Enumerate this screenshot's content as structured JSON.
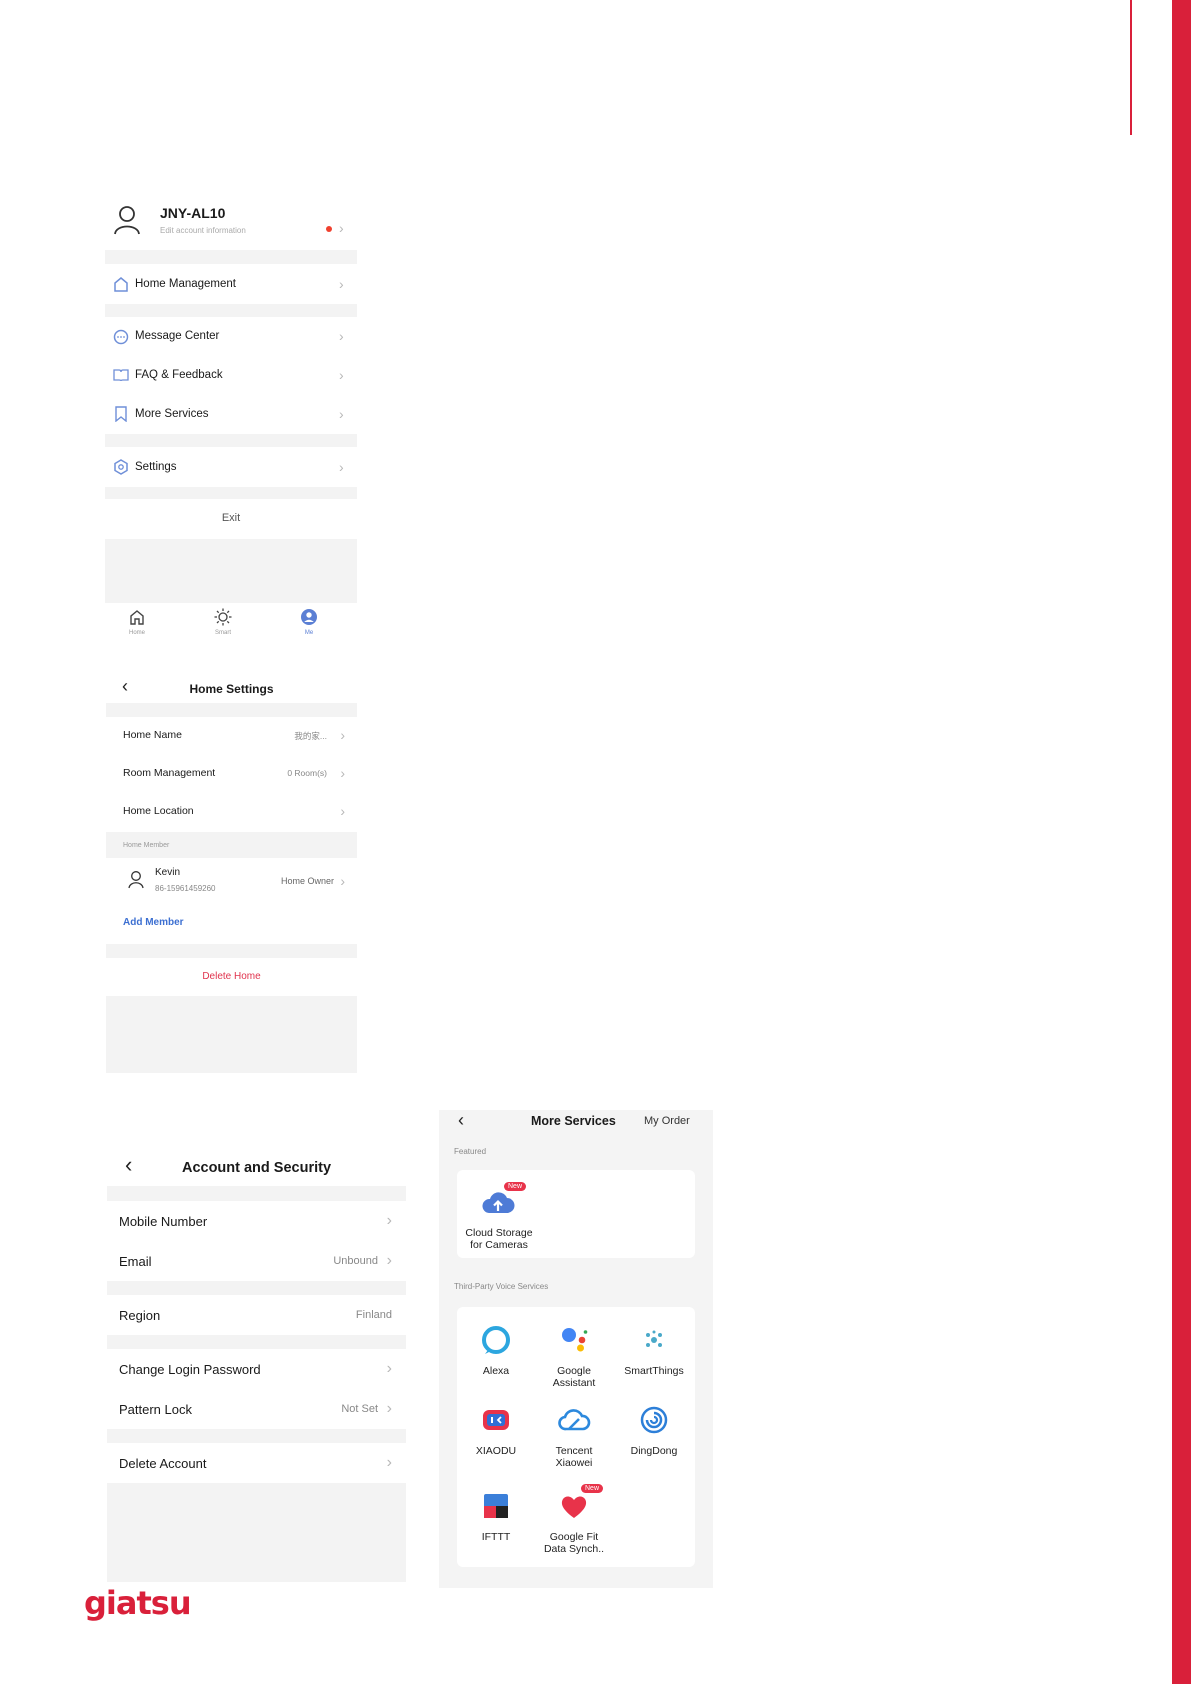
{
  "brand": {
    "logo_text": "giatsu",
    "accent": "#d9203a"
  },
  "me_screen": {
    "user_name": "JNY-AL10",
    "user_sub": "Edit account information",
    "menu": [
      {
        "label": "Home Management",
        "icon": "home-outline-icon"
      },
      {
        "label": "Message Center",
        "icon": "message-icon"
      },
      {
        "label": "FAQ & Feedback",
        "icon": "book-icon"
      },
      {
        "label": "More Services",
        "icon": "bookmark-icon"
      },
      {
        "label": "Settings",
        "icon": "settings-icon"
      }
    ],
    "exit_label": "Exit",
    "tabbar": [
      {
        "label": "Home",
        "icon": "home-icon"
      },
      {
        "label": "Smart",
        "icon": "sun-icon"
      },
      {
        "label": "Me",
        "icon": "user-filled-icon"
      }
    ]
  },
  "home_settings": {
    "title": "Home Settings",
    "rows": [
      {
        "label": "Home Name",
        "value": "我的家..."
      },
      {
        "label": "Room Management",
        "value": "0 Room(s)"
      },
      {
        "label": "Home Location",
        "value": ""
      }
    ],
    "member_section": "Home Member",
    "member": {
      "name": "Kevin",
      "phone": "86-15961459260",
      "role": "Home Owner"
    },
    "add_member": "Add Member",
    "delete_home": "Delete Home"
  },
  "account_security": {
    "title": "Account and Security",
    "rows": [
      {
        "label": "Mobile Number",
        "value": ""
      },
      {
        "label": "Email",
        "value": "Unbound"
      },
      {
        "label": "Region",
        "value": "Finland"
      },
      {
        "label": "Change Login Password",
        "value": ""
      },
      {
        "label": "Pattern Lock",
        "value": "Not Set"
      },
      {
        "label": "Delete Account",
        "value": ""
      }
    ]
  },
  "more_services": {
    "title": "More Services",
    "my_order": "My Order",
    "featured_label": "Featured",
    "featured_item": "Cloud Storage for Cameras",
    "featured_line1": "Cloud Storage",
    "featured_line2": "for Cameras",
    "new_badge": "New",
    "voice_label": "Third-Party Voice Services",
    "services": [
      {
        "line1": "Alexa",
        "line2": "",
        "icon": "alexa-icon"
      },
      {
        "line1": "Google",
        "line2": "Assistant",
        "icon": "google-assistant-icon"
      },
      {
        "line1": "SmartThings",
        "line2": "",
        "icon": "smartthings-icon"
      },
      {
        "line1": "XIAODU",
        "line2": "",
        "icon": "xiaodu-icon"
      },
      {
        "line1": "Tencent",
        "line2": "Xiaowei",
        "icon": "tencent-cloud-icon"
      },
      {
        "line1": "DingDong",
        "line2": "",
        "icon": "dingdong-icon"
      },
      {
        "line1": "IFTTT",
        "line2": "",
        "icon": "ifttt-icon"
      },
      {
        "line1": "Google Fit",
        "line2": "Data Synch..",
        "icon": "heart-icon"
      }
    ]
  }
}
